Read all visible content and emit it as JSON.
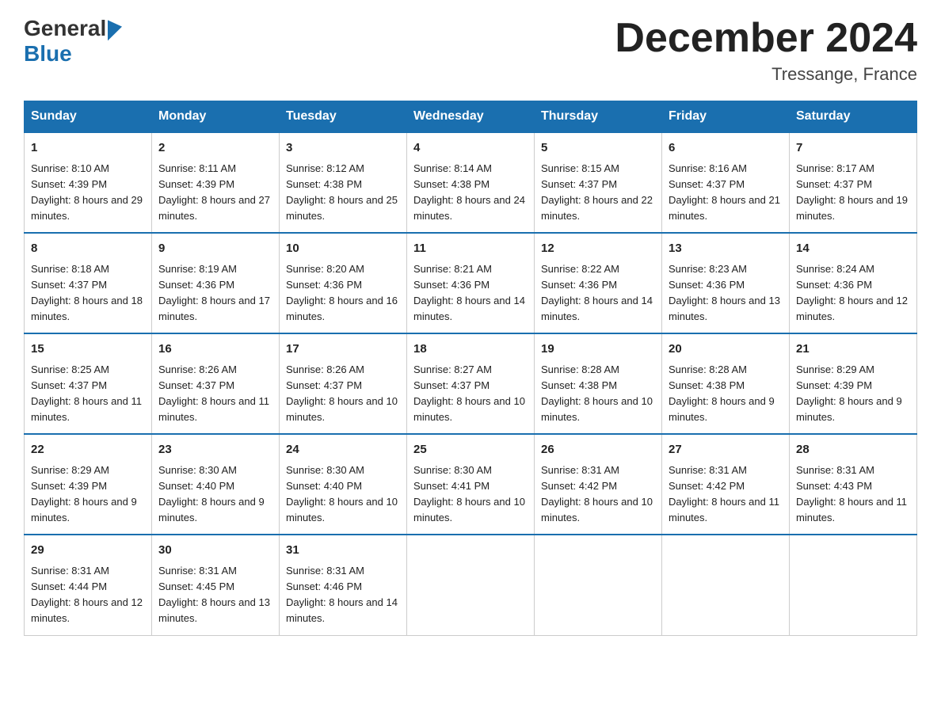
{
  "header": {
    "month_title": "December 2024",
    "location": "Tressange, France"
  },
  "days_of_week": [
    "Sunday",
    "Monday",
    "Tuesday",
    "Wednesday",
    "Thursday",
    "Friday",
    "Saturday"
  ],
  "weeks": [
    [
      {
        "day": "1",
        "sunrise": "8:10 AM",
        "sunset": "4:39 PM",
        "daylight": "8 hours and 29 minutes."
      },
      {
        "day": "2",
        "sunrise": "8:11 AM",
        "sunset": "4:39 PM",
        "daylight": "8 hours and 27 minutes."
      },
      {
        "day": "3",
        "sunrise": "8:12 AM",
        "sunset": "4:38 PM",
        "daylight": "8 hours and 25 minutes."
      },
      {
        "day": "4",
        "sunrise": "8:14 AM",
        "sunset": "4:38 PM",
        "daylight": "8 hours and 24 minutes."
      },
      {
        "day": "5",
        "sunrise": "8:15 AM",
        "sunset": "4:37 PM",
        "daylight": "8 hours and 22 minutes."
      },
      {
        "day": "6",
        "sunrise": "8:16 AM",
        "sunset": "4:37 PM",
        "daylight": "8 hours and 21 minutes."
      },
      {
        "day": "7",
        "sunrise": "8:17 AM",
        "sunset": "4:37 PM",
        "daylight": "8 hours and 19 minutes."
      }
    ],
    [
      {
        "day": "8",
        "sunrise": "8:18 AM",
        "sunset": "4:37 PM",
        "daylight": "8 hours and 18 minutes."
      },
      {
        "day": "9",
        "sunrise": "8:19 AM",
        "sunset": "4:36 PM",
        "daylight": "8 hours and 17 minutes."
      },
      {
        "day": "10",
        "sunrise": "8:20 AM",
        "sunset": "4:36 PM",
        "daylight": "8 hours and 16 minutes."
      },
      {
        "day": "11",
        "sunrise": "8:21 AM",
        "sunset": "4:36 PM",
        "daylight": "8 hours and 14 minutes."
      },
      {
        "day": "12",
        "sunrise": "8:22 AM",
        "sunset": "4:36 PM",
        "daylight": "8 hours and 14 minutes."
      },
      {
        "day": "13",
        "sunrise": "8:23 AM",
        "sunset": "4:36 PM",
        "daylight": "8 hours and 13 minutes."
      },
      {
        "day": "14",
        "sunrise": "8:24 AM",
        "sunset": "4:36 PM",
        "daylight": "8 hours and 12 minutes."
      }
    ],
    [
      {
        "day": "15",
        "sunrise": "8:25 AM",
        "sunset": "4:37 PM",
        "daylight": "8 hours and 11 minutes."
      },
      {
        "day": "16",
        "sunrise": "8:26 AM",
        "sunset": "4:37 PM",
        "daylight": "8 hours and 11 minutes."
      },
      {
        "day": "17",
        "sunrise": "8:26 AM",
        "sunset": "4:37 PM",
        "daylight": "8 hours and 10 minutes."
      },
      {
        "day": "18",
        "sunrise": "8:27 AM",
        "sunset": "4:37 PM",
        "daylight": "8 hours and 10 minutes."
      },
      {
        "day": "19",
        "sunrise": "8:28 AM",
        "sunset": "4:38 PM",
        "daylight": "8 hours and 10 minutes."
      },
      {
        "day": "20",
        "sunrise": "8:28 AM",
        "sunset": "4:38 PM",
        "daylight": "8 hours and 9 minutes."
      },
      {
        "day": "21",
        "sunrise": "8:29 AM",
        "sunset": "4:39 PM",
        "daylight": "8 hours and 9 minutes."
      }
    ],
    [
      {
        "day": "22",
        "sunrise": "8:29 AM",
        "sunset": "4:39 PM",
        "daylight": "8 hours and 9 minutes."
      },
      {
        "day": "23",
        "sunrise": "8:30 AM",
        "sunset": "4:40 PM",
        "daylight": "8 hours and 9 minutes."
      },
      {
        "day": "24",
        "sunrise": "8:30 AM",
        "sunset": "4:40 PM",
        "daylight": "8 hours and 10 minutes."
      },
      {
        "day": "25",
        "sunrise": "8:30 AM",
        "sunset": "4:41 PM",
        "daylight": "8 hours and 10 minutes."
      },
      {
        "day": "26",
        "sunrise": "8:31 AM",
        "sunset": "4:42 PM",
        "daylight": "8 hours and 10 minutes."
      },
      {
        "day": "27",
        "sunrise": "8:31 AM",
        "sunset": "4:42 PM",
        "daylight": "8 hours and 11 minutes."
      },
      {
        "day": "28",
        "sunrise": "8:31 AM",
        "sunset": "4:43 PM",
        "daylight": "8 hours and 11 minutes."
      }
    ],
    [
      {
        "day": "29",
        "sunrise": "8:31 AM",
        "sunset": "4:44 PM",
        "daylight": "8 hours and 12 minutes."
      },
      {
        "day": "30",
        "sunrise": "8:31 AM",
        "sunset": "4:45 PM",
        "daylight": "8 hours and 13 minutes."
      },
      {
        "day": "31",
        "sunrise": "8:31 AM",
        "sunset": "4:46 PM",
        "daylight": "8 hours and 14 minutes."
      },
      null,
      null,
      null,
      null
    ]
  ]
}
